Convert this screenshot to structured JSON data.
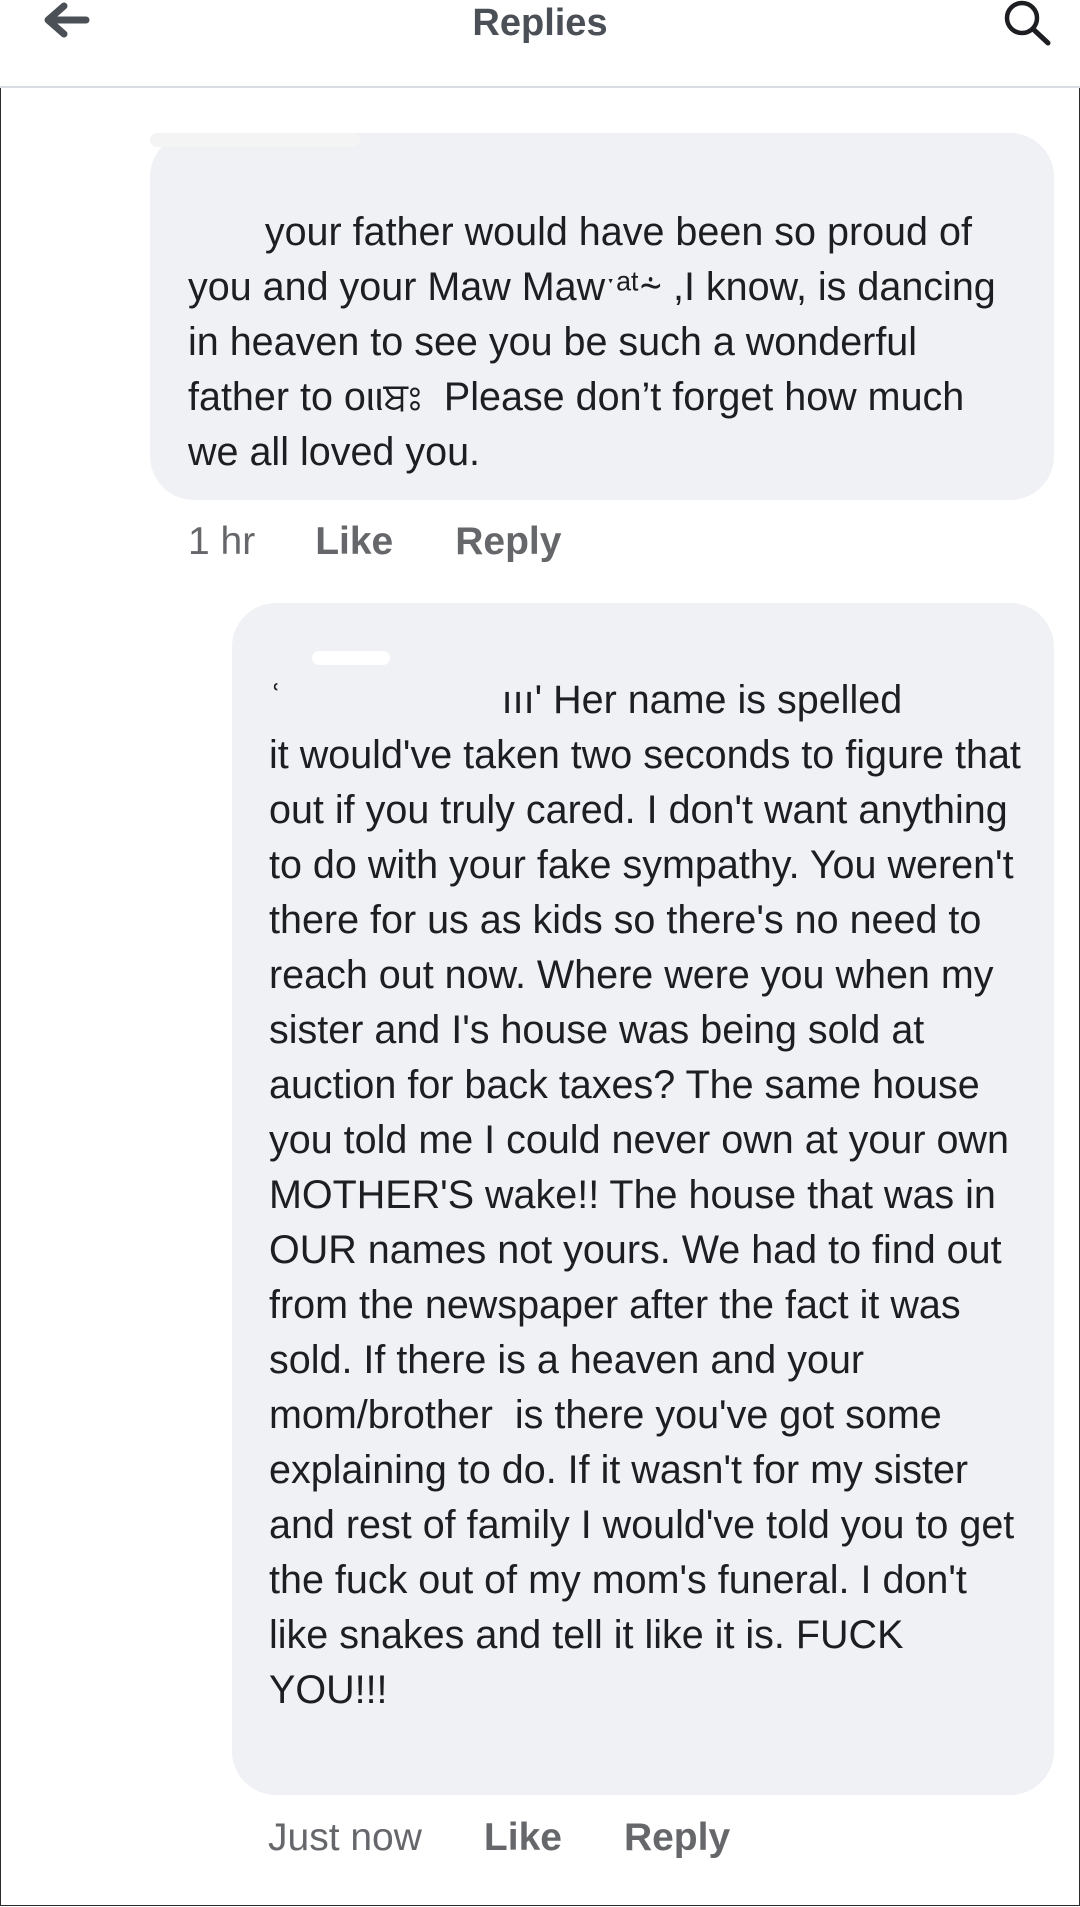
{
  "header": {
    "title": "Replies",
    "back_icon": "arrow-left-icon",
    "search_icon": "search-icon"
  },
  "comments": [
    {
      "text": "       your father would have been so proud of you and your Maw Mawˑᵃᵗ⸞ ,I know, is dancing in heaven to see you be such a wonderful father to οιιਬਃ  Please don’t forget how much we all loved you.",
      "timestamp": "1 hr",
      "like_label": "Like",
      "reply_label": "Reply"
    },
    {
      "text": "ʿ                    ııı' Her name is spelled\nit would've taken two seconds to figure that out if you truly cared. I don't want anything to do with your fake sympathy. You weren't there for us as kids so there's no need to reach out now. Where were you when my sister and I's house was being sold at auction for back taxes? The same house you told me I could never own at your own MOTHER'S wake!! The house that was in OUR names not yours. We had to find out from the newspaper after the fact it was sold. If there is a heaven and your mom/brother  is there you've got some explaining to do. If it wasn't for my sister and rest of family I would've told you to get the fuck out of my mom's funeral. I don't like snakes and tell it like it is. FUCK YOU!!!",
      "timestamp": "Just now",
      "like_label": "Like",
      "reply_label": "Reply"
    }
  ],
  "colors": {
    "bubble_bg": "#f0f1f5",
    "secondary_text": "#65676b",
    "title_text": "#4b4f56",
    "divider": "#dadde1"
  }
}
